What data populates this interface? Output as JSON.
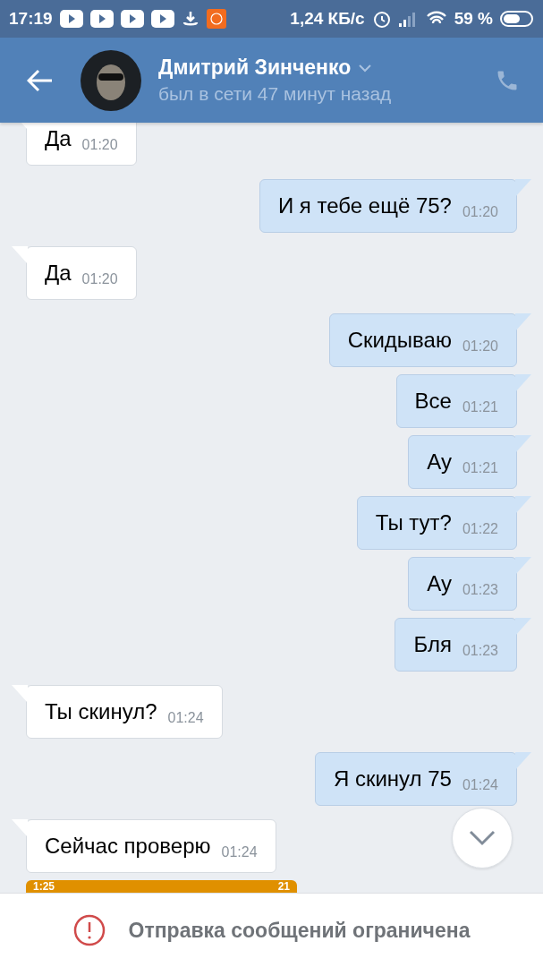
{
  "status_bar": {
    "time": "17:19",
    "speed": "1,24 КБ/с",
    "battery": "59 %"
  },
  "header": {
    "name": "Дмитрий Зинченко",
    "status": "был в сети 47 минут назад"
  },
  "messages": [
    {
      "kind": "incoming",
      "text": "Да",
      "time": "01:20"
    },
    {
      "kind": "outgoing",
      "text": "И я тебе ещё 75?",
      "time": "01:20"
    },
    {
      "kind": "incoming",
      "text": "Да",
      "time": "01:20"
    },
    {
      "kind": "outgoing",
      "text": "Скидываю",
      "time": "01:20"
    },
    {
      "kind": "outgoing",
      "text": "Все",
      "time": "01:21"
    },
    {
      "kind": "outgoing",
      "text": "Ау",
      "time": "01:21"
    },
    {
      "kind": "outgoing",
      "text": "Ты тут?",
      "time": "01:22"
    },
    {
      "kind": "outgoing",
      "text": "Ау",
      "time": "01:23"
    },
    {
      "kind": "outgoing",
      "text": "Бля",
      "time": "01:23"
    },
    {
      "kind": "incoming",
      "text": "Ты скинул?",
      "time": "01:24"
    },
    {
      "kind": "outgoing",
      "text": "Я скинул 75",
      "time": "01:24"
    },
    {
      "kind": "incoming",
      "text": "Сейчас проверю",
      "time": "01:24"
    }
  ],
  "attachment": {
    "time": "1:25",
    "battery": "21"
  },
  "notice": "Отправка сообщений ограничена"
}
